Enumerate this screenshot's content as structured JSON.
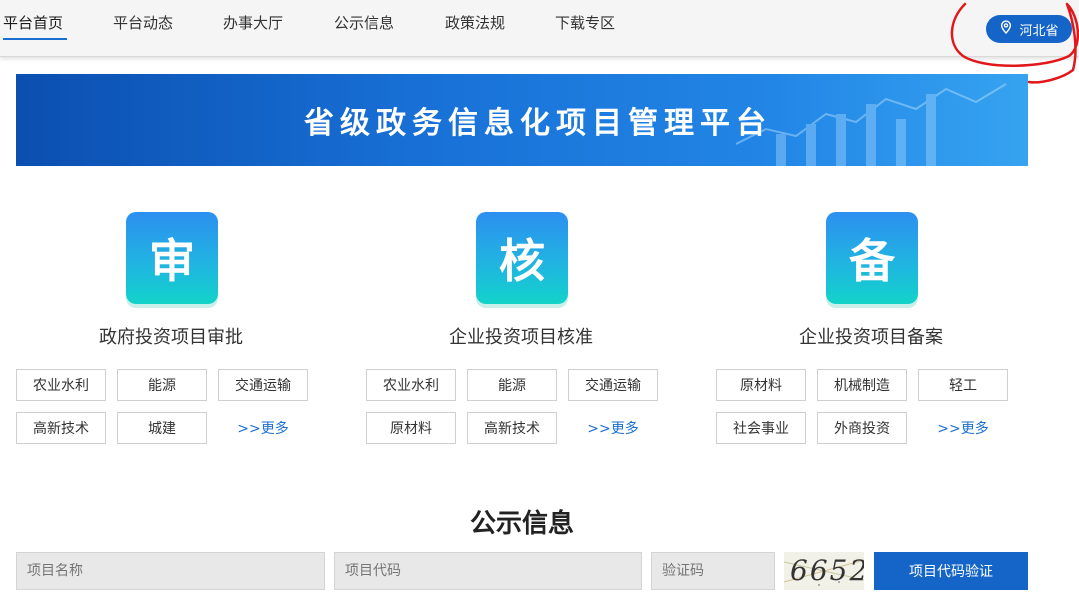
{
  "nav": {
    "items": [
      "平台首页",
      "平台动态",
      "办事大厅",
      "公示信息",
      "政策法规",
      "下载专区"
    ],
    "region": "河北省"
  },
  "banner": {
    "title": "省级政务信息化项目管理平台"
  },
  "sections": [
    {
      "icon_char": "审",
      "title": "政府投资项目审批",
      "tags": [
        "农业水利",
        "能源",
        "交通运输",
        "高新技术",
        "城建"
      ],
      "more": ">>更多"
    },
    {
      "icon_char": "核",
      "title": "企业投资项目核准",
      "tags": [
        "农业水利",
        "能源",
        "交通运输",
        "原材料",
        "高新技术"
      ],
      "more": ">>更多"
    },
    {
      "icon_char": "备",
      "title": "企业投资项目备案",
      "tags": [
        "原材料",
        "机械制造",
        "轻工",
        "社会事业",
        "外商投资"
      ],
      "more": ">>更多"
    }
  ],
  "public_info": {
    "title": "公示信息",
    "project_name_placeholder": "项目名称",
    "project_code_placeholder": "项目代码",
    "captcha_placeholder": "验证码",
    "captcha_text": "6652",
    "verify_button": "项目代码验证"
  },
  "colors": {
    "accent": "#1565c8",
    "link": "#1b6fd1",
    "annotation": "#e0181b"
  },
  "icons": {
    "region": "location-pin-icon"
  }
}
